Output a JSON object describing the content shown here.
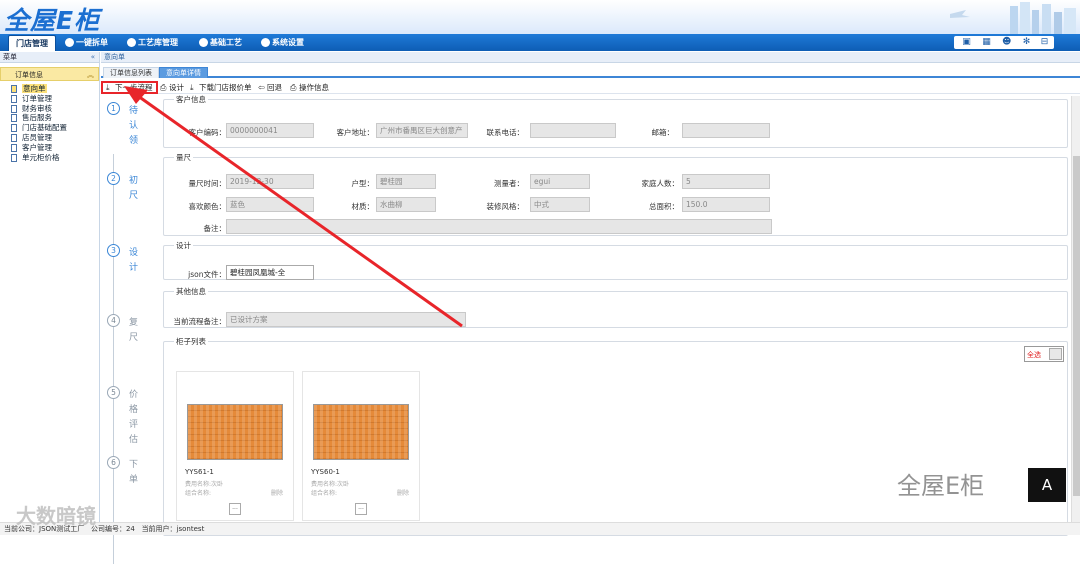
{
  "app": {
    "logo": "全屋E柜"
  },
  "nav": {
    "tabs": [
      {
        "label": "门店管理",
        "icon": "house-icon"
      },
      {
        "label": "一键拆单",
        "icon": "check-circle-icon"
      },
      {
        "label": "工艺库管理",
        "icon": "check-circle-icon"
      },
      {
        "label": "基础工艺",
        "icon": "gear-icon"
      },
      {
        "label": "系统设置",
        "icon": "settings-icon"
      }
    ],
    "right_icons": [
      "monitor-icon",
      "calendar-icon",
      "user-icon",
      "gear-icon",
      "exit-icon"
    ]
  },
  "sidebar": {
    "header": "菜单",
    "group": "订单信息",
    "items": [
      "意向单",
      "订单管理",
      "财务审核",
      "售后服务",
      "门店基础配置",
      "店员管理",
      "客户管理",
      "单元柜价格"
    ]
  },
  "breadcrumb": "意向单",
  "subtabs": [
    "订单信息列表",
    "意向单详情"
  ],
  "toolbar": {
    "next_step": "下一步流程",
    "design": "设计",
    "download_quote": "下载门店报价单",
    "return": "回退",
    "operation_info": "操作信息"
  },
  "steps": [
    {
      "num": "1",
      "label": "待认领",
      "state": "done"
    },
    {
      "num": "2",
      "label": "初尺",
      "state": "done"
    },
    {
      "num": "3",
      "label": "设计",
      "state": "done"
    },
    {
      "num": "4",
      "label": "复尺",
      "state": "todo"
    },
    {
      "num": "5",
      "label": "价格评估",
      "state": "todo"
    },
    {
      "num": "6",
      "label": "下单",
      "state": "todo"
    }
  ],
  "customer": {
    "legend": "客户信息",
    "code_label": "客户编码：",
    "code": "0000000041",
    "address_label": "客户地址：",
    "address": "广州市番禺区巨大创意产",
    "phone_label": "联系电话：",
    "phone": "",
    "email_label": "邮箱：",
    "email": ""
  },
  "measure": {
    "legend": "量尺",
    "time_label": "量尺时间：",
    "time": "2019-12-30",
    "unit_label": "户型：",
    "unit": "碧桂园",
    "measurer_label": "测量者：",
    "measurer": "egui",
    "family_label": "家庭人数：",
    "family": "5",
    "color_label": "喜欢颜色：",
    "color": "蓝色",
    "material_label": "材质：",
    "material": "水曲柳",
    "style_label": "装修风格：",
    "style": "中式",
    "area_label": "总面积：",
    "area": "150.0",
    "remark_label": "备注：",
    "remark": ""
  },
  "design": {
    "legend": "设计",
    "json_label": "json文件：",
    "json_file": "碧桂园凤凰城-全"
  },
  "other": {
    "legend": "其他信息",
    "flow_label": "当前流程备注：",
    "flow_note": "已设计方案"
  },
  "cabinets": {
    "legend": "柜子列表",
    "select_all": "全选",
    "items": [
      {
        "name": "YYS61-1",
        "line1": "费用名称:次卧",
        "line2": "组合名称:",
        "delete": "删除",
        "btn": "..."
      },
      {
        "name": "YYS60-1",
        "line1": "费用名称:次卧",
        "line2": "组合名称:",
        "delete": "删除",
        "btn": "..."
      }
    ]
  },
  "status": {
    "company_label": "当前公司：",
    "company": "JSON测试工厂",
    "company_no_label": "公司编号：",
    "company_no": "24",
    "user_label": "当前用户：",
    "user": "jsontest"
  },
  "watermarks": {
    "left": "大数暗镜",
    "right": "全屋E柜",
    "right_box": "A"
  }
}
